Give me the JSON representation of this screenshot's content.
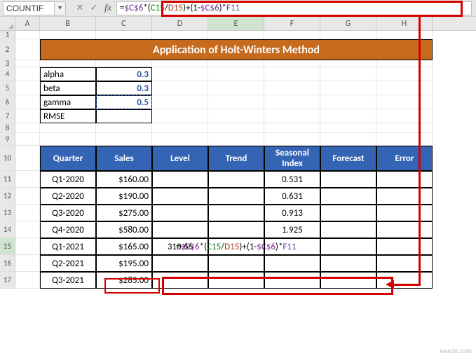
{
  "nameBox": "COUNTIF",
  "formula": {
    "prefix": "=",
    "abs1": "$C$6",
    "op1": "*(",
    "r1": "C15",
    "op2": "/",
    "r2": "D15",
    "op3": ")+(1-",
    "abs2": "$C$6",
    "op4": ")*",
    "r3": "F11"
  },
  "title": "Application of Holt-Winters Method",
  "params": {
    "alpha_l": "alpha",
    "alpha_v": "0.3",
    "beta_l": "beta",
    "beta_v": "0.3",
    "gamma_l": "gamma",
    "gamma_v": "0.5",
    "rmse_l": "RMSE",
    "rmse_v": ""
  },
  "headers": {
    "q": "Quarter",
    "s": "Sales",
    "l": "Level",
    "t": "Trend",
    "si": "Seasonal Index",
    "f": "Forecast",
    "e": "Error"
  },
  "rows": [
    {
      "q": "Q1-2020",
      "s": "$160.00",
      "l": "",
      "t": "",
      "si": "0.531",
      "f": "",
      "e": ""
    },
    {
      "q": "Q2-2020",
      "s": "$190.00",
      "l": "",
      "t": "",
      "si": "0.631",
      "f": "",
      "e": ""
    },
    {
      "q": "Q3-2020",
      "s": "$275.00",
      "l": "",
      "t": "",
      "si": "0.913",
      "f": "",
      "e": ""
    },
    {
      "q": "Q4-2020",
      "s": "$580.00",
      "l": "",
      "t": "",
      "si": "1.925",
      "f": "",
      "e": ""
    },
    {
      "q": "Q1-2021",
      "s": "$165.00",
      "l": "310.66",
      "t": "__FORMULA__",
      "si": "",
      "f": "",
      "e": ""
    },
    {
      "q": "Q2-2021",
      "s": "$195.00",
      "l": "",
      "t": "",
      "si": "",
      "f": "",
      "e": ""
    },
    {
      "q": "Q3-2021",
      "s": "$285.00",
      "l": "",
      "t": "",
      "si": "",
      "f": "",
      "e": ""
    }
  ],
  "cols": [
    "A",
    "B",
    "C",
    "D",
    "E",
    "F",
    "G",
    "H"
  ],
  "watermark": "wsxdn.com",
  "chart_data": null
}
